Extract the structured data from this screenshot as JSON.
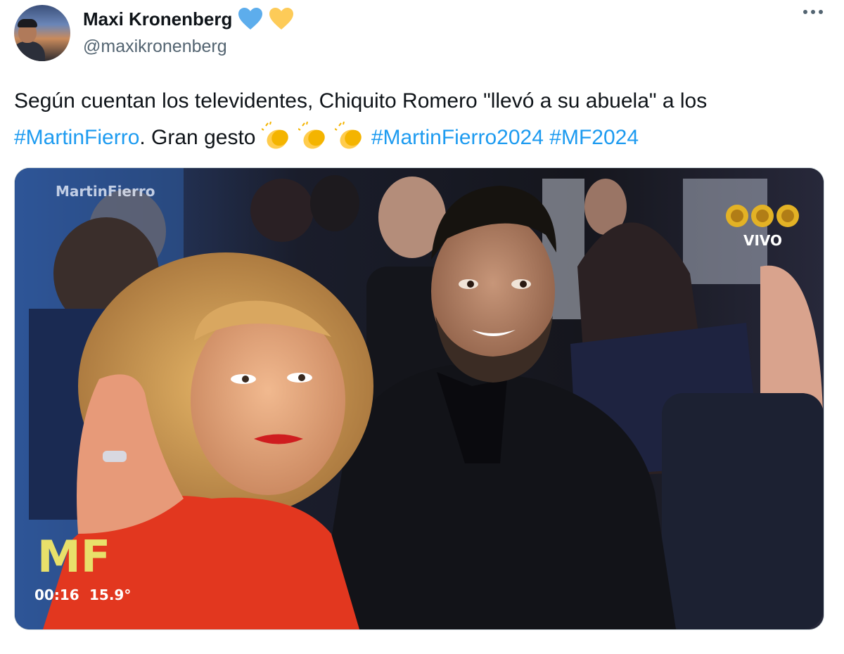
{
  "author": {
    "display_name": "Maxi Kronenberg",
    "handle": "@maxikronenberg",
    "badges": [
      "blue-heart-icon",
      "yellow-heart-icon"
    ]
  },
  "tweet": {
    "part1": "Según cuentan los televidentes, Chiquito Romero \"llevó a su abuela\" a los ",
    "hashtag1": "#MartinFierro",
    "part2": ". Gran gesto ",
    "emojis": [
      "clapping-hands-icon",
      "clapping-hands-icon",
      "clapping-hands-icon"
    ],
    "hashtag2": "#MartinFierro2024",
    "hashtag3": "#MF2024"
  },
  "media": {
    "watermark": "MartinFierro",
    "live_label": "VIVO",
    "logo": "MF",
    "time": "00:16",
    "temperature": "15.9°"
  },
  "colors": {
    "text": "#0f1419",
    "secondary": "#536471",
    "link": "#1d9bf0"
  }
}
